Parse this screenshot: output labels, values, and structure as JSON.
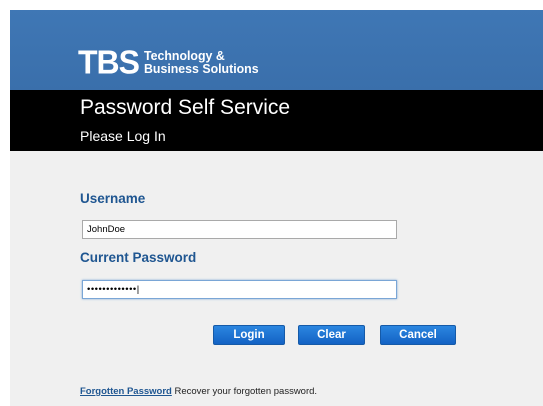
{
  "brand": {
    "logo_mark": "TBS",
    "logo_text": "Technology &\nBusiness Solutions"
  },
  "header": {
    "title": "Password Self Service",
    "subtitle": "Please Log In"
  },
  "form": {
    "username_label": "Username",
    "username_value": "JohnDoe",
    "password_label": "Current Password",
    "password_value": "•••••••••••••|"
  },
  "buttons": {
    "login": "Login",
    "clear": "Clear",
    "cancel": "Cancel"
  },
  "footer": {
    "link": "Forgotten Password",
    "text": " Recover your forgotten password."
  },
  "colors": {
    "brand_blue": "#3f77b5",
    "header_black": "#000000",
    "label_blue": "#1f5691",
    "button_blue": "#1f74d4"
  }
}
